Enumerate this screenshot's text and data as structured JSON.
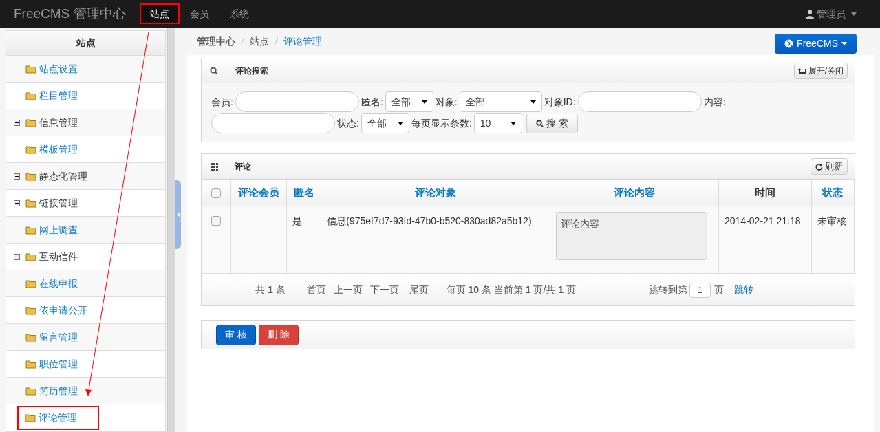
{
  "navbar": {
    "brand": "FreeCMS 管理中心",
    "tabs": [
      {
        "label": "站点",
        "selected": true,
        "highlighted": true
      },
      {
        "label": "会员",
        "selected": false,
        "highlighted": false
      },
      {
        "label": "系统",
        "selected": false,
        "highlighted": false
      }
    ],
    "user": "管理员"
  },
  "sidebar": {
    "title": "站点",
    "items": [
      {
        "label": "站点设置",
        "has_children": false,
        "highlighted": false
      },
      {
        "label": "栏目管理",
        "has_children": false,
        "highlighted": false
      },
      {
        "label": "信息管理",
        "has_children": true,
        "highlighted": false
      },
      {
        "label": "模板管理",
        "has_children": false,
        "highlighted": false
      },
      {
        "label": "静态化管理",
        "has_children": true,
        "highlighted": false
      },
      {
        "label": "链接管理",
        "has_children": true,
        "highlighted": false
      },
      {
        "label": "网上调查",
        "has_children": false,
        "highlighted": false
      },
      {
        "label": "互动信件",
        "has_children": true,
        "highlighted": false
      },
      {
        "label": "在线申报",
        "has_children": false,
        "highlighted": false
      },
      {
        "label": "依申请公开",
        "has_children": false,
        "highlighted": false
      },
      {
        "label": "留言管理",
        "has_children": false,
        "highlighted": false
      },
      {
        "label": "职位管理",
        "has_children": false,
        "highlighted": false
      },
      {
        "label": "简历管理",
        "has_children": false,
        "highlighted": false
      },
      {
        "label": "评论管理",
        "has_children": false,
        "highlighted": true
      }
    ]
  },
  "breadcrumb": [
    "管理中心",
    "站点",
    "评论管理"
  ],
  "site_button": "FreeCMS",
  "search_panel": {
    "title": "评论搜索",
    "toggle": "展开/关闭",
    "fields": [
      {
        "kind": "text",
        "label": "会员:"
      },
      {
        "kind": "select",
        "label": "匿名:",
        "value": "全部"
      },
      {
        "kind": "select",
        "label": "对象:",
        "value": "全部"
      },
      {
        "kind": "text",
        "label": "对象ID:"
      },
      {
        "kind": "text",
        "label": "内容:"
      },
      {
        "kind": "select",
        "label": "状态:",
        "value": "全部"
      },
      {
        "kind": "select",
        "label": "每页显示条数:",
        "value": "10"
      }
    ],
    "search_button": "搜 索"
  },
  "list_panel": {
    "title": "评论",
    "refresh": "刷新",
    "select_all_checked": false,
    "columns": [
      {
        "label": "评论会员",
        "sortable": true
      },
      {
        "label": "匿名",
        "sortable": true
      },
      {
        "label": "评论对象",
        "sortable": true
      },
      {
        "label": "评论内容",
        "sortable": true
      },
      {
        "label": "时间",
        "sortable": false
      },
      {
        "label": "状态",
        "sortable": true
      }
    ],
    "rows": [
      {
        "checked": false,
        "member": "",
        "anonymous": "是",
        "target": "信息(975ef7d7-93fd-47b0-b520-830ad82a5b12)",
        "content": "评论内容",
        "time": "2014-02-21 21:18",
        "status": "未审核"
      }
    ],
    "pager": {
      "total_prefix": "共",
      "total": "1",
      "total_suffix": "条",
      "links": [
        "首页",
        "上一页",
        "下一页",
        "尾页"
      ],
      "per_page_prefix": "每页",
      "per_page": "10",
      "per_page_mid": "条 当前第",
      "current": "1",
      "of": "页/共",
      "pages": "1",
      "pages_suffix": "页",
      "jump_label": "跳转到第",
      "jump_value": "1",
      "jump_suffix": "页",
      "jump_button": "跳转"
    }
  },
  "actions": [
    {
      "label": "审 核",
      "kind": "primary"
    },
    {
      "label": "删 除",
      "kind": "danger"
    }
  ]
}
